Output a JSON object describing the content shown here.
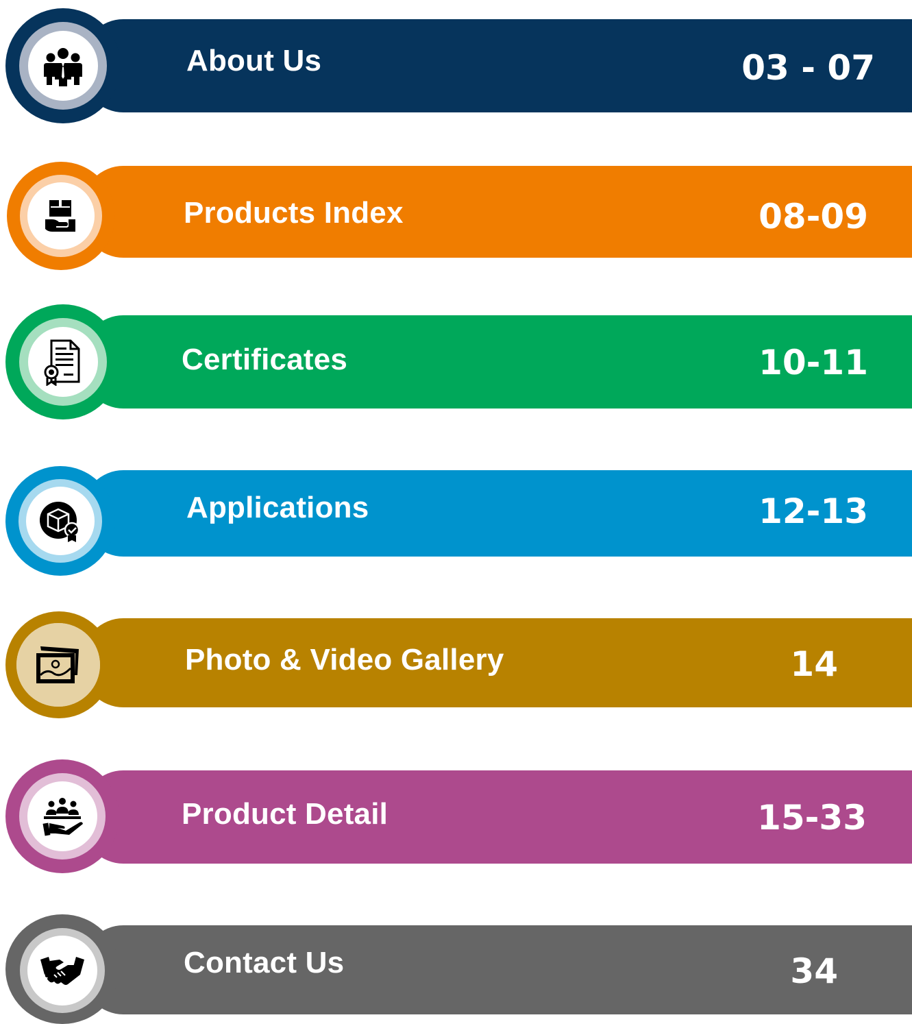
{
  "toc": [
    {
      "label": "About Us",
      "pages": "03 - 07",
      "color": "#06345c",
      "ring": "#a9b3c4",
      "icon": "team-icon"
    },
    {
      "label": "Products Index",
      "pages": "08-09",
      "color": "#f07d00",
      "ring": "#fbcfa7",
      "icon": "product-hand-icon"
    },
    {
      "label": "Certificates",
      "pages": "10-11",
      "color": "#00a85a",
      "ring": "#a5dfbf",
      "icon": "certificate-icon"
    },
    {
      "label": "Applications",
      "pages": "12-13",
      "color": "#0093cd",
      "ring": "#a6d9ef",
      "icon": "box-check-icon"
    },
    {
      "label": "Photo & Video Gallery",
      "pages": "14",
      "color": "#b88200",
      "ring": "#e6d2a4",
      "icon": "gallery-icon"
    },
    {
      "label": "Product Detail",
      "pages": "15-33",
      "color": "#ad4a8d",
      "ring": "#e2bed7",
      "icon": "people-hand-icon"
    },
    {
      "label": "Contact Us",
      "pages": "34",
      "color": "#666666",
      "ring": "#c8c8c8",
      "icon": "handshake-icon"
    }
  ]
}
